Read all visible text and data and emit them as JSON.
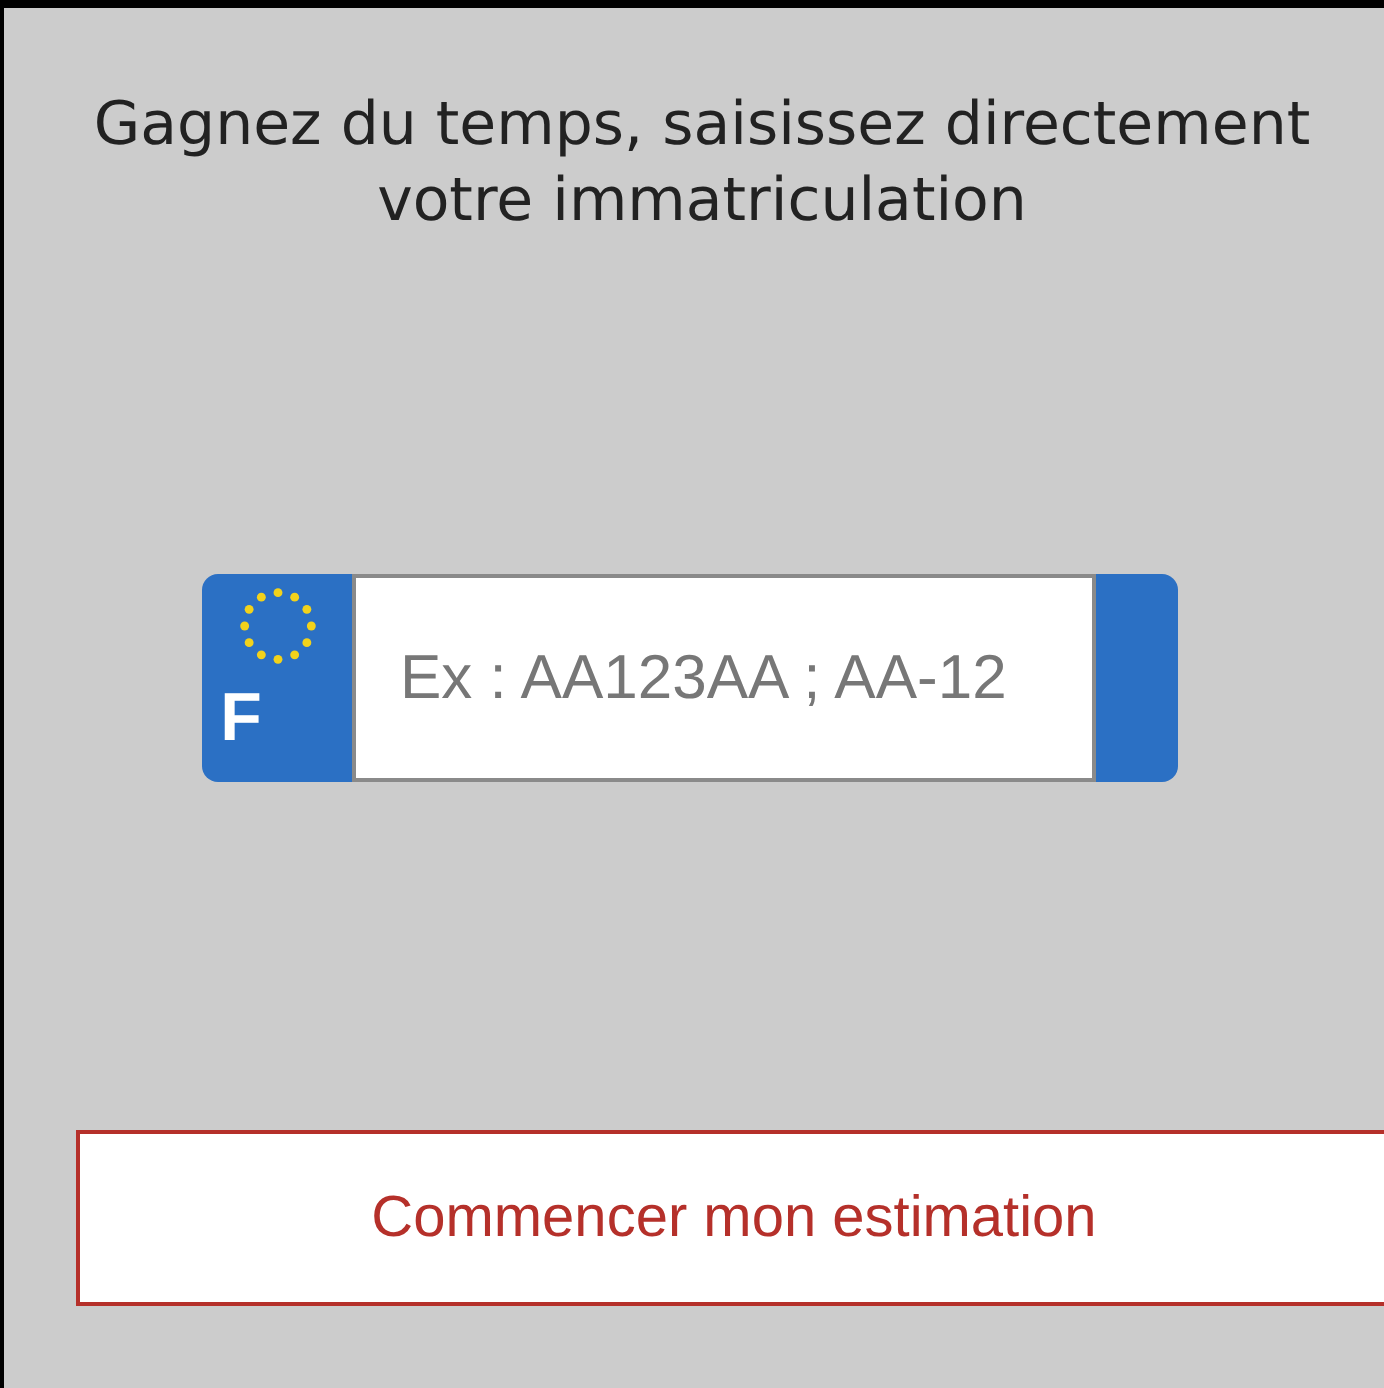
{
  "heading": "Gagnez du temps, saisissez directement votre immatriculation",
  "plate": {
    "country_code": "F",
    "placeholder": "Ex : AA123AA ; AA-12"
  },
  "button": "Commencer mon estimation"
}
